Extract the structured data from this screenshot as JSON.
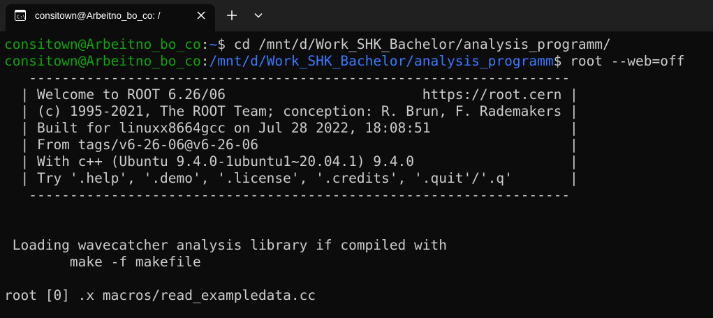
{
  "tab": {
    "title": "consitown@Arbeitno_bo_co: /",
    "icon": "terminal-icon",
    "close_icon": "close-icon"
  },
  "toolbar": {
    "new_tab_icon": "plus-icon",
    "dropdown_icon": "chevron-down-icon"
  },
  "terminal": {
    "line1": {
      "user": "consitown@Arbeitno_bo_co",
      "sep": ":",
      "path": "~",
      "cmd": "$ cd /mnt/d/Work_SHK_Bachelor/analysis_programm/"
    },
    "line2": {
      "user": "consitown@Arbeitno_bo_co",
      "sep": ":",
      "path": "/mnt/d/Work_SHK_Bachelor/analysis_programm",
      "cmd": "$ root --web=off"
    },
    "banner": [
      "   ------------------------------------------------------------------",
      "  | Welcome to ROOT 6.26/06                        https://root.cern |",
      "  | (c) 1995-2021, The ROOT Team; conception: R. Brun, F. Rademakers |",
      "  | Built for linuxx8664gcc on Jul 28 2022, 18:08:51                 |",
      "  | From tags/v6-26-06@v6-26-06                                      |",
      "  | With c++ (Ubuntu 9.4.0-1ubuntu1~20.04.1) 9.4.0                   |",
      "  | Try '.help', '.demo', '.license', '.credits', '.quit'/'.q'       |",
      "   ------------------------------------------------------------------"
    ],
    "loading1": " Loading wavecatcher analysis library if compiled with",
    "loading2": "        make -f makefile",
    "prompt": "root [0] .x macros/read_exampledata.cc"
  },
  "colors": {
    "background": "#0c0c0c",
    "tabbar": "#202020",
    "user": "#13a10e",
    "path": "#3b78ff",
    "text": "#cccccc"
  }
}
